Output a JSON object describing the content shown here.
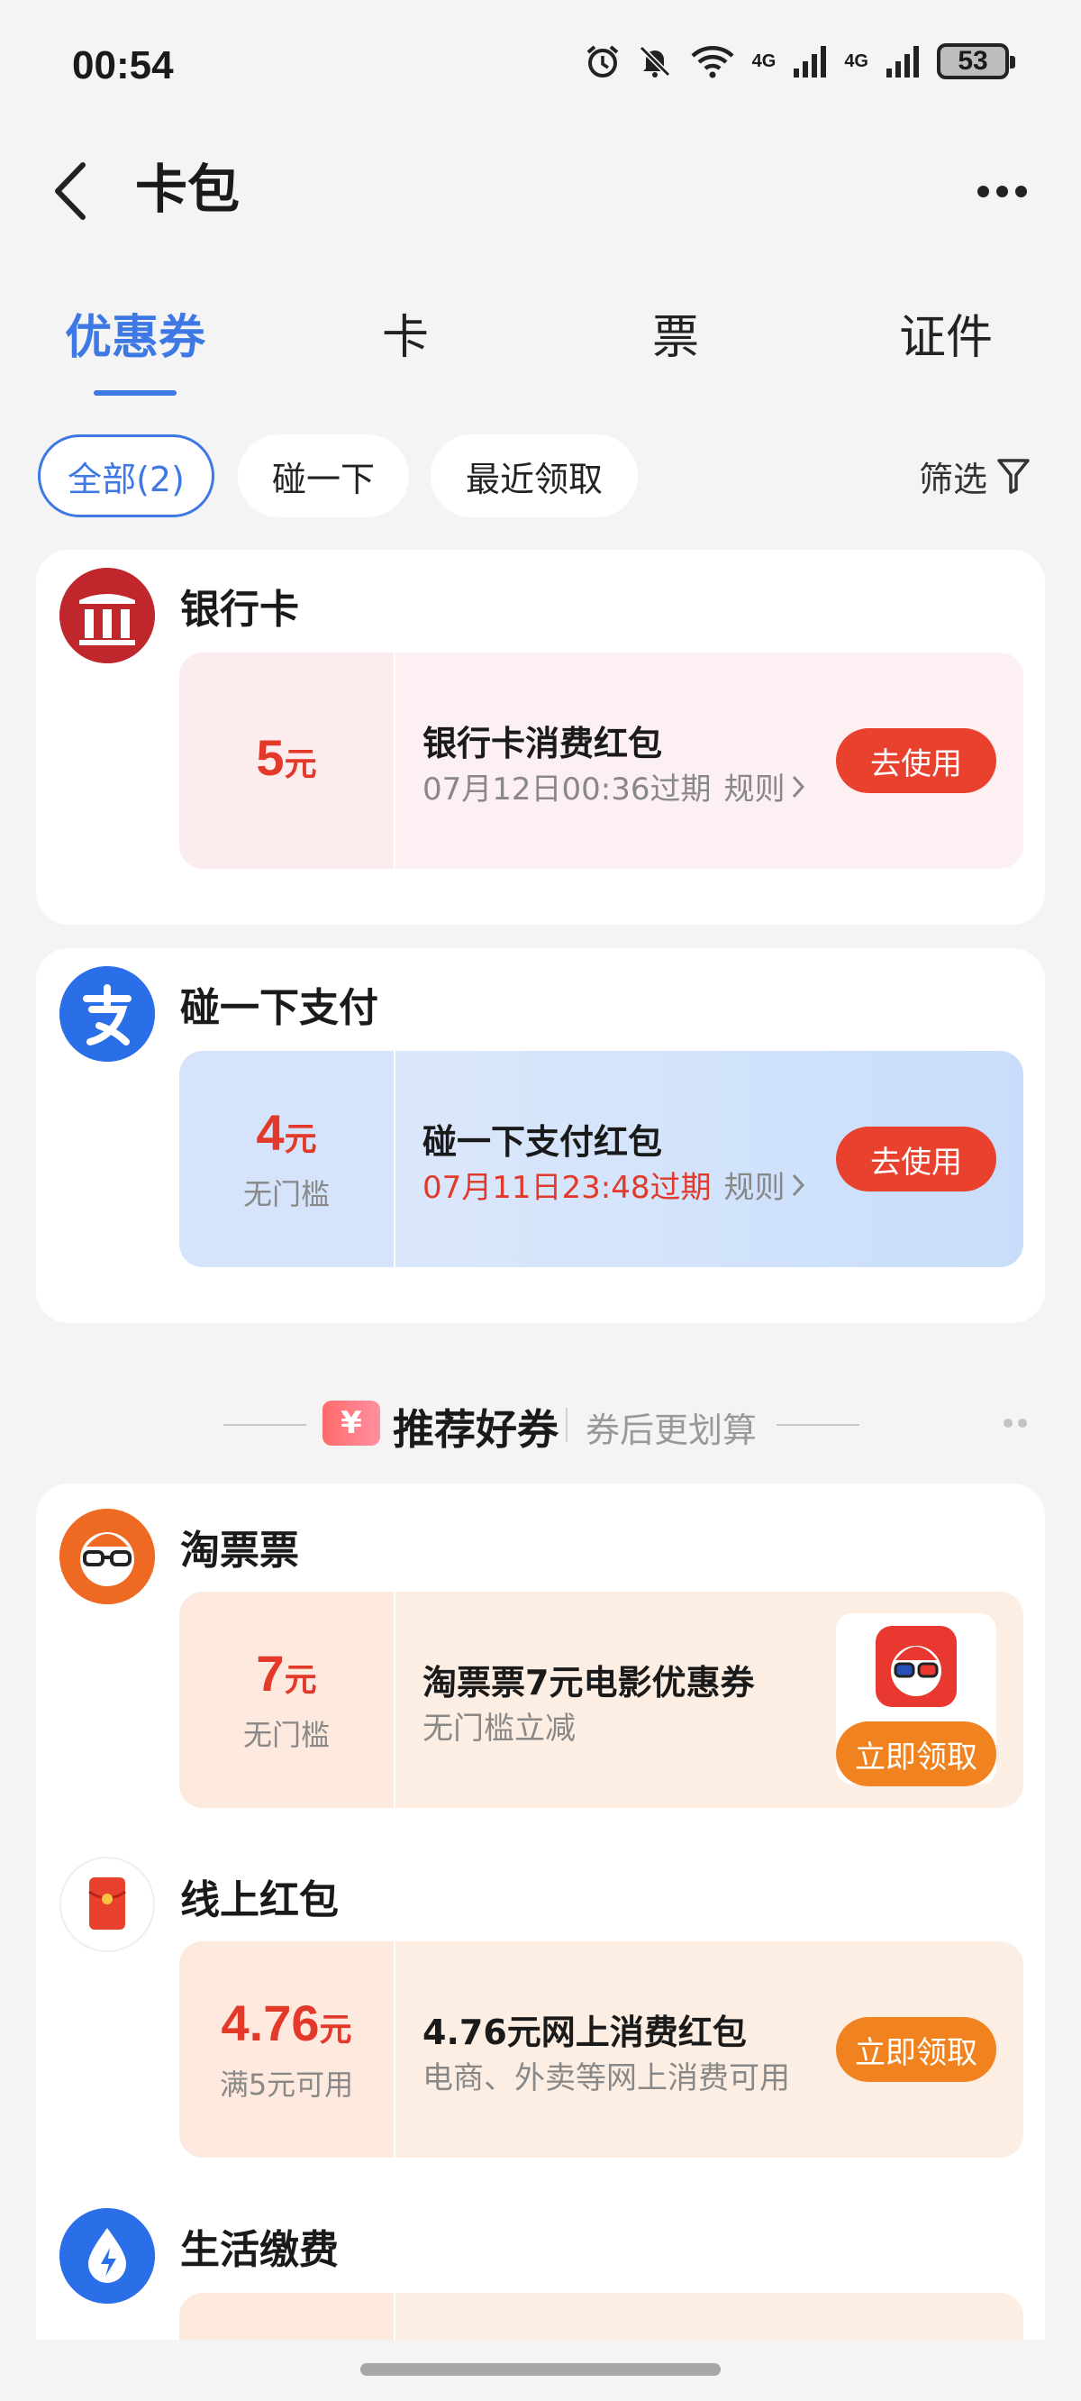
{
  "status_bar": {
    "time": "00:54",
    "network_1": "4G",
    "network_2": "4G",
    "battery": "53"
  },
  "header": {
    "title": "卡包"
  },
  "tabs": [
    {
      "label": "优惠券",
      "active": true
    },
    {
      "label": "卡",
      "active": false
    },
    {
      "label": "票",
      "active": false
    },
    {
      "label": "证件",
      "active": false
    }
  ],
  "chips": [
    {
      "label": "全部(2)",
      "active": true
    },
    {
      "label": "碰一下",
      "active": false
    },
    {
      "label": "最近领取",
      "active": false
    }
  ],
  "filter_label": "筛选",
  "my_coupons": [
    {
      "merchant": "银行卡",
      "amount": "5",
      "unit": "元",
      "condition": "",
      "title": "银行卡消费红包",
      "expiry": "07月12日00:36过期",
      "rule": "规则",
      "action": "去使用"
    },
    {
      "merchant": "碰一下支付",
      "amount": "4",
      "unit": "元",
      "condition": "无门槛",
      "title": "碰一下支付红包",
      "expiry": "07月11日23:48过期",
      "rule": "规则",
      "action": "去使用"
    }
  ],
  "recommend": {
    "ticket_icon": "¥",
    "title": "推荐好券",
    "subtitle": "券后更划算"
  },
  "recommended_coupons": [
    {
      "merchant": "淘票票",
      "amount": "7",
      "unit": "元",
      "condition": "无门槛",
      "title": "淘票票7元电影优惠券",
      "desc": "无门槛立减",
      "action": "立即领取"
    },
    {
      "merchant": "线上红包",
      "amount": "4.76",
      "unit": "元",
      "condition": "满5元可用",
      "title": "4.76元网上消费红包",
      "desc": "电商、外卖等网上消费可用",
      "action": "立即领取"
    },
    {
      "merchant": "生活缴费"
    }
  ],
  "colors": {
    "accent_blue": "#3d78e4",
    "coupon_red": "#e2392a",
    "claim_orange": "#f0831f"
  }
}
